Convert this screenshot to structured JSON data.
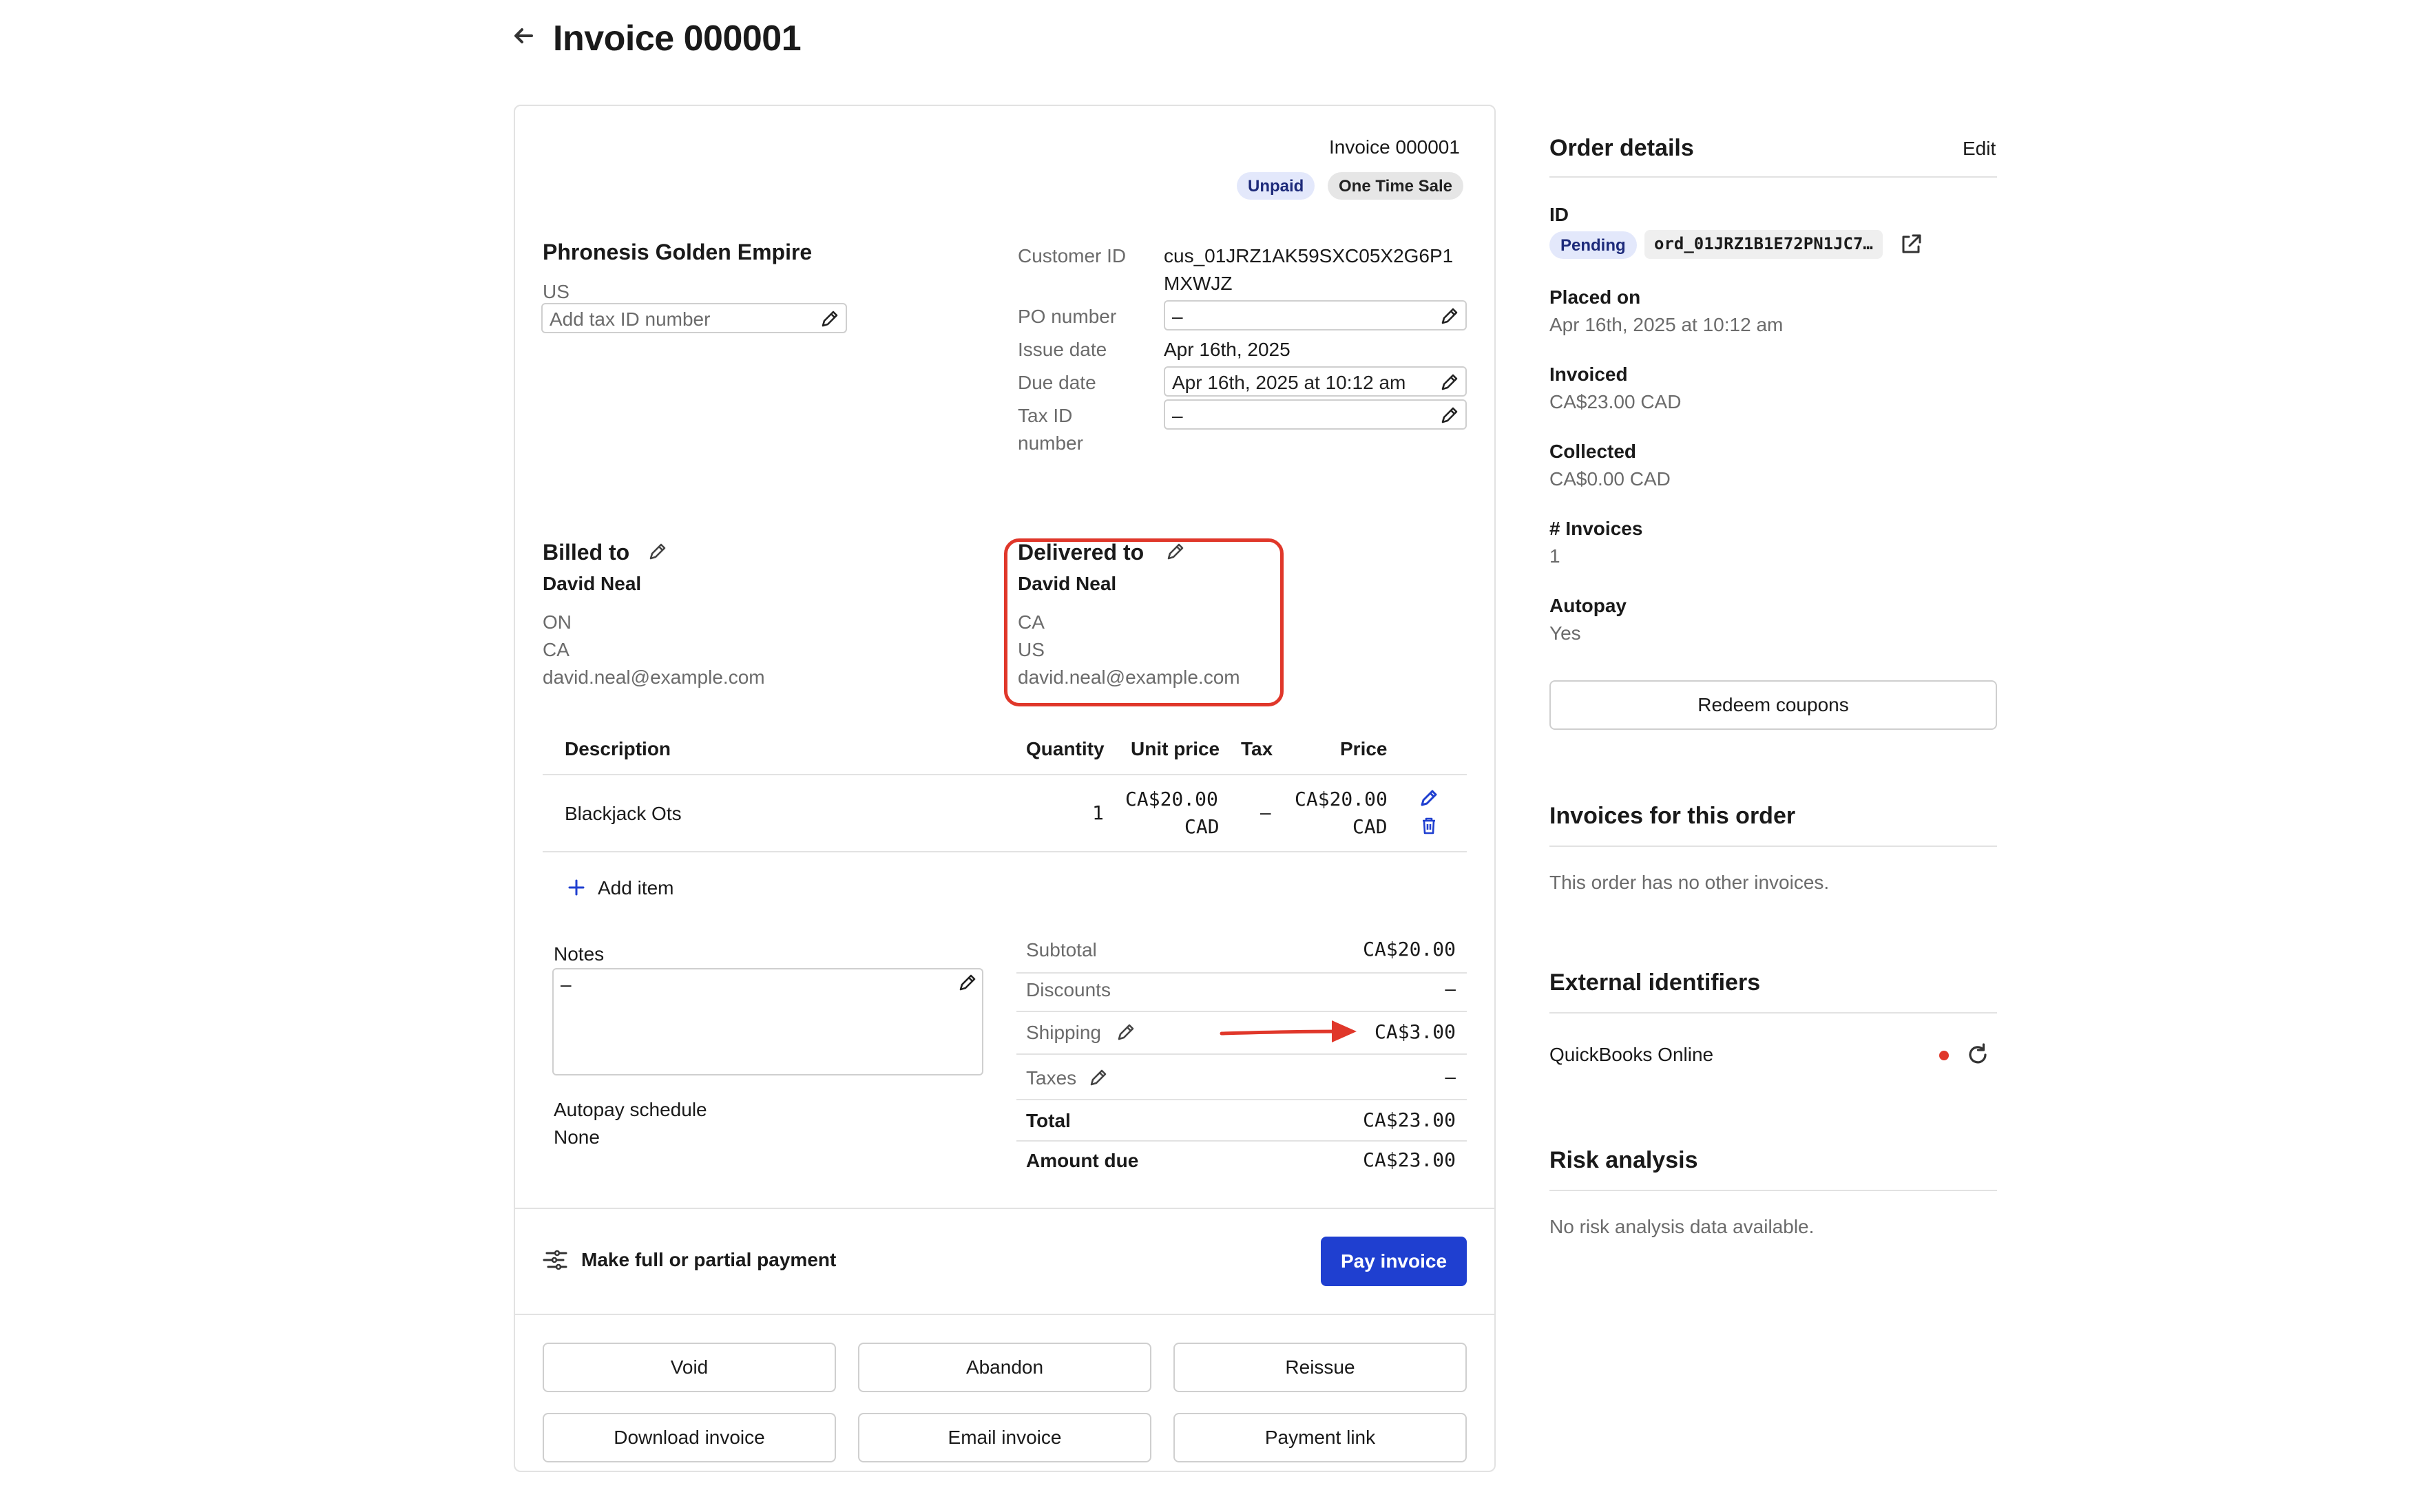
{
  "header": {
    "title": "Invoice 000001"
  },
  "invoice": {
    "number_label": "Invoice 000001",
    "badges": [
      "Unpaid",
      "One Time Sale"
    ],
    "customer_name": "Phronesis Golden Empire",
    "customer_country": "US",
    "tax_id_placeholder": "Add tax ID number",
    "fields": {
      "customer_id_label": "Customer ID",
      "customer_id_line1": "cus_01JRZ1AK59SXC05X2G6P1",
      "customer_id_line2": "MXWJZ",
      "po_label": "PO number",
      "po_value": "–",
      "issue_label": "Issue date",
      "issue_value": "Apr 16th, 2025",
      "due_label": "Due date",
      "due_value": "Apr 16th, 2025 at 10:12 am",
      "tax_label_1": "Tax ID",
      "tax_label_2": "number",
      "tax_value": "–"
    },
    "billed": {
      "title": "Billed to",
      "name": "David Neal",
      "line1": "ON",
      "line2": "CA",
      "email": "david.neal@example.com"
    },
    "delivered": {
      "title": "Delivered to",
      "name": "David Neal",
      "line1": "CA",
      "line2": "US",
      "email": "david.neal@example.com"
    },
    "table": {
      "headers": [
        "Description",
        "Quantity",
        "Unit price",
        "Tax",
        "Price"
      ],
      "rows": [
        {
          "description": "Blackjack Ots",
          "quantity": "1",
          "unit_price_1": "CA$20.00",
          "unit_price_2": "CAD",
          "tax": "–",
          "price_1": "CA$20.00",
          "price_2": "CAD"
        }
      ],
      "add_item": "Add item"
    },
    "notes": {
      "label": "Notes",
      "value": "–"
    },
    "autopay": {
      "label": "Autopay schedule",
      "value": "None"
    },
    "totals": {
      "subtotal_label": "Subtotal",
      "subtotal": "CA$20.00",
      "discounts_label": "Discounts",
      "discounts": "–",
      "shipping_label": "Shipping",
      "shipping": "CA$3.00",
      "taxes_label": "Taxes",
      "taxes": "–",
      "total_label": "Total",
      "total": "CA$23.00",
      "due_label": "Amount due",
      "due": "CA$23.00"
    },
    "payment": {
      "label": "Make full or partial payment",
      "button": "Pay invoice"
    },
    "actions": [
      "Void",
      "Abandon",
      "Reissue",
      "Download invoice",
      "Email invoice",
      "Payment link"
    ]
  },
  "sidebar": {
    "order_title": "Order details",
    "edit": "Edit",
    "id_label": "ID",
    "status": "Pending",
    "order_id": "ord_01JRZ1B1E72PN1JC7…",
    "placed_label": "Placed on",
    "placed_value": "Apr 16th, 2025 at 10:12 am",
    "invoiced_label": "Invoiced",
    "invoiced_value": "CA$23.00 CAD",
    "collected_label": "Collected",
    "collected_value": "CA$0.00 CAD",
    "count_label": "# Invoices",
    "count_value": "1",
    "autopay_label": "Autopay",
    "autopay_value": "Yes",
    "redeem": "Redeem coupons",
    "invoices_title": "Invoices for this order",
    "invoices_empty": "This order has no other invoices.",
    "external_title": "External identifiers",
    "quickbooks": "QuickBooks Online",
    "risk_title": "Risk analysis",
    "risk_empty": "No risk analysis data available."
  },
  "colors": {
    "accent": "#1f3fd0",
    "annotation": "#e0372a",
    "status_dot": "#e0372a"
  }
}
